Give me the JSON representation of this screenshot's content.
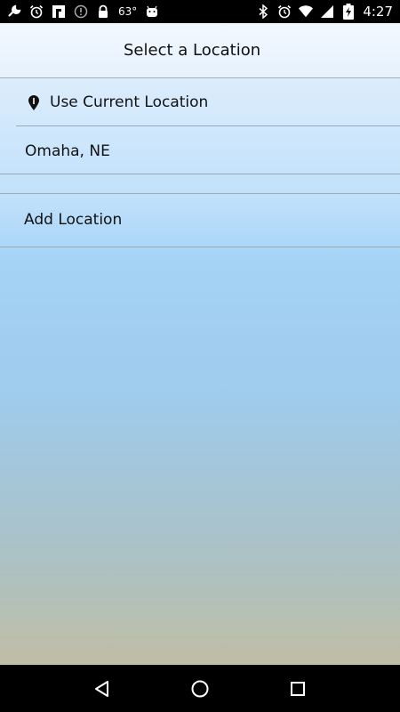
{
  "status_bar": {
    "temperature": "63°",
    "time": "4:27",
    "left_icons": [
      "wrench-icon",
      "alarm-icon",
      "flipboard-icon",
      "info-icon",
      "lock-icon",
      "android-icon"
    ],
    "right_icons": [
      "bluetooth-icon",
      "alarm-icon",
      "wifi-icon",
      "signal-icon",
      "battery-charging-icon"
    ]
  },
  "header": {
    "title": "Select a Location"
  },
  "locations": {
    "current_label": "Use Current Location",
    "current_icon": "location-pin-icon",
    "saved": [
      "Omaha, NE"
    ],
    "add_label": "Add Location"
  },
  "nav_bar": {
    "buttons": [
      "back-icon",
      "home-icon",
      "recents-icon"
    ]
  },
  "colors": {
    "status_bar_bg": "#000000",
    "nav_bar_bg": "#000000",
    "text": "#111111",
    "divider": "#9ea9b4"
  }
}
